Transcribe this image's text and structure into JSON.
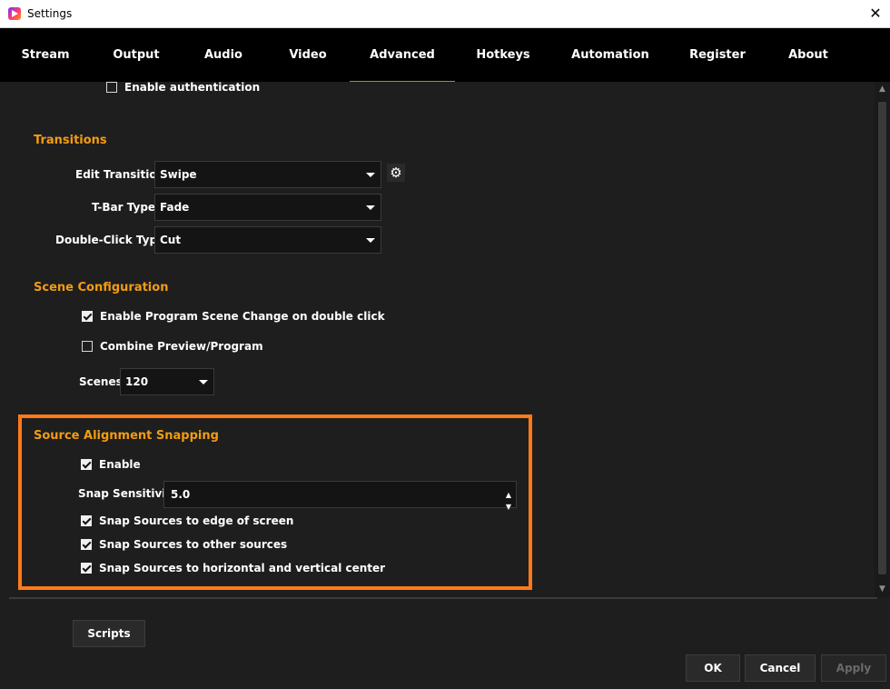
{
  "window": {
    "title": "Settings",
    "close_glyph": "✕"
  },
  "tabs": [
    {
      "label": "Stream"
    },
    {
      "label": "Output"
    },
    {
      "label": "Audio"
    },
    {
      "label": "Video"
    },
    {
      "label": "Advanced"
    },
    {
      "label": "Hotkeys"
    },
    {
      "label": "Automation"
    },
    {
      "label": "Register"
    },
    {
      "label": "About"
    }
  ],
  "active_tab": "Advanced",
  "auth": {
    "label": "Enable authentication",
    "checked": false
  },
  "transitions": {
    "title": "Transitions",
    "edit_transition": {
      "label": "Edit Transition",
      "value": "Swipe"
    },
    "tbar_type": {
      "label": "T-Bar Type",
      "value": "Fade"
    },
    "double_click_type": {
      "label": "Double-Click Type",
      "value": "Cut"
    }
  },
  "scene_config": {
    "title": "Scene Configuration",
    "program_change": {
      "label": "Enable Program Scene Change on double click",
      "checked": true
    },
    "combine": {
      "label": "Combine Preview/Program",
      "checked": false
    },
    "scenes": {
      "label": "Scenes",
      "value": "120"
    }
  },
  "snapping": {
    "title": "Source Alignment Snapping",
    "enable": {
      "label": "Enable",
      "checked": true
    },
    "sensitivity": {
      "label": "Snap Sensitivity",
      "value": "5.0"
    },
    "edge": {
      "label": "Snap Sources to edge of screen",
      "checked": true
    },
    "other": {
      "label": "Snap Sources to other sources",
      "checked": true
    },
    "center": {
      "label": "Snap Sources to horizontal and vertical center",
      "checked": true
    }
  },
  "buttons": {
    "scripts": "Scripts",
    "ok": "OK",
    "cancel": "Cancel",
    "apply": "Apply"
  },
  "colors": {
    "accent": "#f39c12",
    "highlight": "#ff7a1a",
    "background": "#1e1e1e",
    "tabbar": "#000000"
  }
}
